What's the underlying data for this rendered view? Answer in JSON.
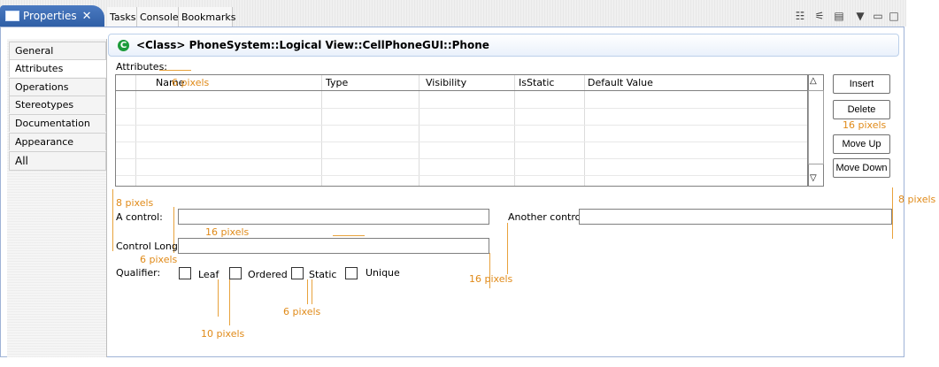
{
  "tabs": {
    "active": "Properties",
    "others": [
      "Tasks",
      "Console",
      "Bookmarks"
    ]
  },
  "sidebar": {
    "items": [
      "General",
      "Attributes",
      "Operations",
      "Stereotypes",
      "Documentation",
      "Appearance",
      "All"
    ],
    "selected": "Attributes"
  },
  "header": {
    "class_icon": "C",
    "title": "<Class> PhoneSystem::Logical View::CellPhoneGUI::Phone"
  },
  "attributes_label": "Attributes:",
  "table": {
    "columns": [
      "Name",
      "Type",
      "Visibility",
      "IsStatic",
      "Default Value"
    ],
    "rows": [
      [],
      [],
      [],
      [],
      [],
      []
    ]
  },
  "buttons": [
    "Insert",
    "Delete",
    "Move Up",
    "Move Down"
  ],
  "form": {
    "a_control_label": "A control:",
    "another_control_label": "Another control:",
    "control_long_label": "Control Long:",
    "qualifier_label": "Qualifier:",
    "qualifiers": [
      "Leaf",
      "Ordered",
      "Static",
      "Unique"
    ]
  },
  "annotations": {
    "name_pixels": "6 pixels",
    "delete_pixels": "16 pixels",
    "right_pixels": "8 pixels",
    "left_pixels": "8 pixels",
    "a_control_pixels": "16 pixels",
    "control_long_pixels": "6 pixels",
    "another_pixels": "16 pixels",
    "static_pixels": "6 pixels",
    "leaf_pixels": "10 pixels"
  },
  "colors": {
    "active_tab": "#3a6bb4",
    "annotation": "#e08a18",
    "class_icon": "#1c9b3a"
  }
}
